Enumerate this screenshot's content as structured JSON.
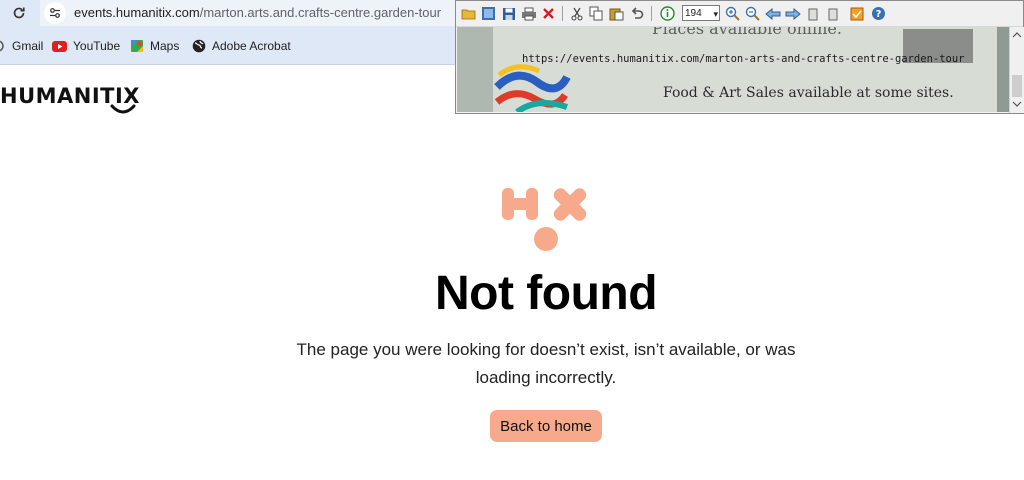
{
  "browser": {
    "url_domain": "events.humanitix.com",
    "url_path": "/marton.arts.and.crafts-centre.garden-tour",
    "bookmarks": [
      {
        "label": "Gmail",
        "icon": "gmail-icon"
      },
      {
        "label": "YouTube",
        "icon": "youtube-icon"
      },
      {
        "label": "Maps",
        "icon": "maps-icon"
      },
      {
        "label": "Adobe Acrobat",
        "icon": "globe-icon"
      }
    ]
  },
  "header": {
    "logo_text": "Humanitix"
  },
  "main": {
    "title": "Not found",
    "message": "The page you were looking for doesn’t exist, isn’t available, or was loading incorrectly.",
    "button_label": "Back to home"
  },
  "viewer": {
    "zoom_value": "194",
    "photo_line1": "Places available online.",
    "photo_url": "https://events.humanitix.com/marton-arts-and-crafts-centre-garden-tour",
    "photo_line2": "Food & Art Sales available at some sites."
  },
  "colors": {
    "accent": "#f7a98b",
    "chrome_bar": "#dfe8f6",
    "text": "#000000"
  }
}
